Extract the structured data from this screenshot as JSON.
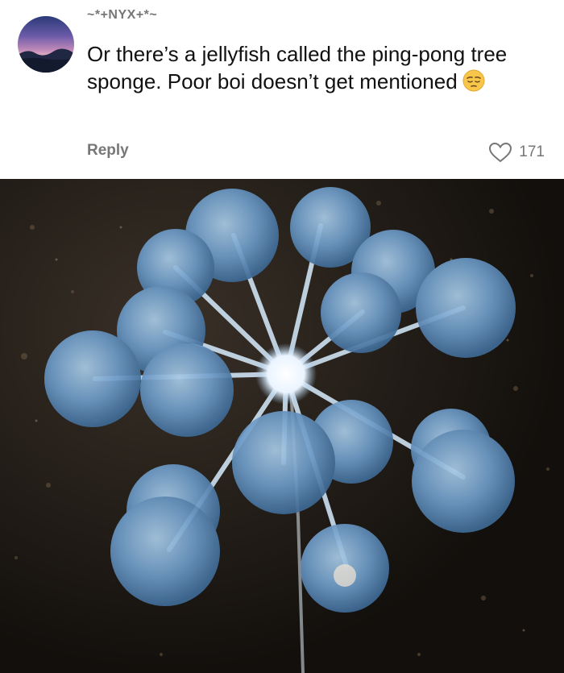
{
  "comment": {
    "username": "~*+NYX+*~",
    "text": "Or there’s a jellyfish called the ping-pong tree sponge. Poor boi doesn’t get mentioned",
    "emoji": "pensive-face-emoji",
    "reply_label": "Reply",
    "like_count": "171",
    "like_icon": "heart-outline-icon"
  },
  "photo": {
    "subject": "ping-pong tree sponge"
  },
  "colors": {
    "meta_text": "#777777",
    "body_text": "#111111",
    "sphere": "#6f9cc8"
  }
}
